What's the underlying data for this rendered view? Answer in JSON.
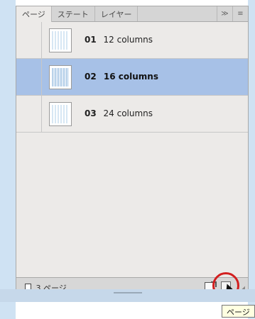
{
  "tabs": [
    {
      "label": "ページ"
    },
    {
      "label": "ステート"
    },
    {
      "label": "レイヤー"
    }
  ],
  "tab_controls": {
    "collapse_icon": "≫",
    "menu_icon": "≡"
  },
  "pages": [
    {
      "number": "01",
      "title": "12 columns",
      "selected": false
    },
    {
      "number": "02",
      "title": "16 columns",
      "selected": true
    },
    {
      "number": "03",
      "title": "24 columns",
      "selected": false
    }
  ],
  "status": {
    "page_count": "3 ページ"
  },
  "tooltip": {
    "text": "ページ"
  },
  "colors": {
    "selection": "#a7c1e7",
    "highlight": "#d21f1f"
  }
}
